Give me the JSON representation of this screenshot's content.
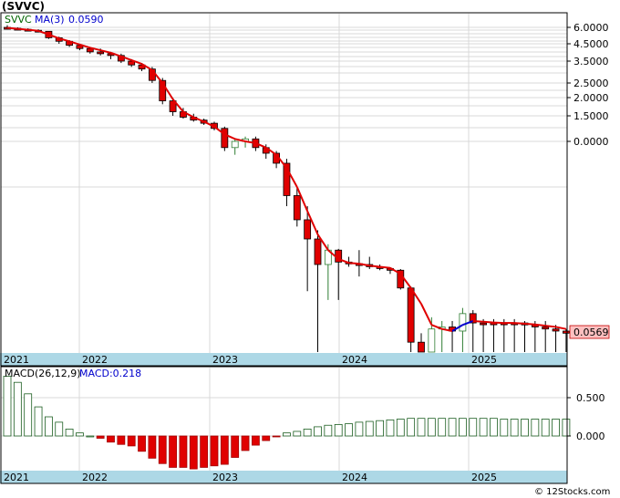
{
  "ticker": "(SVVC)",
  "legend": {
    "symbol": "SVVC",
    "ma_label": "MA(3)",
    "ma_value": "0.0590",
    "macd_label": "MACD(26,12,9)",
    "macd_value": "MACD:0.218"
  },
  "last_price_label": "0.0569",
  "watermark": "© 12Stocks.com",
  "year_labels": [
    "2021",
    "2022",
    "2023",
    "2024",
    "2025"
  ],
  "price_ticks": [
    "6.0000",
    "4.5000",
    "3.5000",
    "2.5000",
    "2.0000",
    "1.5000",
    "0.0000"
  ],
  "macd_ticks": [
    "0.500",
    "0.000"
  ],
  "colors": {
    "up": "#2e7d32",
    "down": "#e00000",
    "ma": "#e00000",
    "ma_alt": "#0000cc",
    "band": "#add8e6",
    "price_tag_bg": "#ffc0c0",
    "grid": "#d8d8d8"
  },
  "chart_data": {
    "type": "candlestick",
    "interval": "monthly",
    "series": [
      {
        "name": "SVVC",
        "role": "price",
        "values": [
          [
            6.0,
            6.2,
            5.8,
            5.9
          ],
          [
            5.9,
            6.0,
            5.7,
            5.8
          ],
          [
            5.8,
            5.9,
            5.6,
            5.7
          ],
          [
            5.7,
            5.8,
            5.5,
            5.6
          ],
          [
            5.6,
            5.6,
            4.9,
            5.0
          ],
          [
            5.0,
            5.1,
            4.5,
            4.7
          ],
          [
            4.7,
            4.8,
            4.3,
            4.4
          ],
          [
            4.4,
            4.5,
            4.1,
            4.2
          ],
          [
            4.2,
            4.3,
            3.9,
            4.0
          ],
          [
            4.0,
            4.2,
            3.8,
            3.9
          ],
          [
            3.9,
            4.0,
            3.6,
            3.8
          ],
          [
            3.8,
            3.9,
            3.4,
            3.5
          ],
          [
            3.5,
            3.6,
            3.2,
            3.3
          ],
          [
            3.3,
            3.4,
            3.0,
            3.1
          ],
          [
            3.1,
            3.2,
            2.5,
            2.6
          ],
          [
            2.6,
            2.7,
            1.8,
            1.9
          ],
          [
            1.9,
            2.0,
            1.5,
            1.6
          ],
          [
            1.6,
            1.7,
            1.4,
            1.45
          ],
          [
            1.45,
            1.55,
            1.3,
            1.35
          ],
          [
            1.35,
            1.4,
            1.2,
            1.25
          ],
          [
            1.25,
            1.3,
            1.05,
            1.1
          ],
          [
            1.1,
            1.15,
            0.65,
            0.7
          ],
          [
            0.7,
            0.85,
            0.6,
            0.8
          ],
          [
            0.8,
            0.9,
            0.7,
            0.85
          ],
          [
            0.85,
            0.9,
            0.65,
            0.7
          ],
          [
            0.7,
            0.75,
            0.55,
            0.62
          ],
          [
            0.62,
            0.65,
            0.45,
            0.5
          ],
          [
            0.5,
            0.55,
            0.2,
            0.25
          ],
          [
            0.25,
            0.3,
            0.13,
            0.15
          ],
          [
            0.15,
            0.2,
            0.04,
            0.1
          ],
          [
            0.1,
            0.12,
            0.02,
            0.06
          ],
          [
            0.06,
            0.09,
            0.035,
            0.08
          ],
          [
            0.08,
            0.082,
            0.035,
            0.063
          ],
          [
            0.063,
            0.07,
            0.058,
            0.061
          ],
          [
            0.061,
            0.08,
            0.05,
            0.06
          ],
          [
            0.06,
            0.07,
            0.056,
            0.058
          ],
          [
            0.058,
            0.06,
            0.055,
            0.0565
          ],
          [
            0.0565,
            0.0575,
            0.052,
            0.055
          ],
          [
            0.055,
            0.056,
            0.041,
            0.042
          ],
          [
            0.042,
            0.043,
            0.02,
            0.022
          ],
          [
            0.022,
            0.024,
            0.018,
            0.02
          ],
          [
            0.02,
            0.028,
            0.018,
            0.025
          ],
          [
            0.025,
            0.027,
            0.018,
            0.0255
          ],
          [
            0.0255,
            0.027,
            0.018,
            0.0245
          ],
          [
            0.0245,
            0.031,
            0.02,
            0.029
          ],
          [
            0.029,
            0.03,
            0.0185,
            0.0265
          ],
          [
            0.0265,
            0.0275,
            0.0185,
            0.0265
          ],
          [
            0.0265,
            0.0275,
            0.0185,
            0.0265
          ],
          [
            0.0265,
            0.0275,
            0.0185,
            0.0265
          ],
          [
            0.0265,
            0.0275,
            0.0185,
            0.0265
          ],
          [
            0.0265,
            0.027,
            0.0185,
            0.026
          ],
          [
            0.026,
            0.027,
            0.0185,
            0.0255
          ],
          [
            0.0255,
            0.027,
            0.0185,
            0.025
          ],
          [
            0.025,
            0.026,
            0.0185,
            0.0245
          ],
          [
            0.0245,
            0.025,
            0.019,
            0.024
          ]
        ]
      },
      {
        "name": "MA(3)",
        "role": "ma",
        "values": [
          5.95,
          5.85,
          5.75,
          5.65,
          5.3,
          4.95,
          4.7,
          4.45,
          4.25,
          4.1,
          3.95,
          3.75,
          3.55,
          3.35,
          3.05,
          2.5,
          1.95,
          1.6,
          1.45,
          1.3,
          1.15,
          0.95,
          0.85,
          0.8,
          0.77,
          0.7,
          0.6,
          0.45,
          0.3,
          0.18,
          0.11,
          0.08,
          0.067,
          0.062,
          0.061,
          0.059,
          0.058,
          0.057,
          0.052,
          0.042,
          0.033,
          0.026,
          0.025,
          0.0245,
          0.026,
          0.027,
          0.0268,
          0.0266,
          0.0265,
          0.0265,
          0.0263,
          0.0261,
          0.0258,
          0.0255,
          0.025
        ]
      },
      {
        "name": "MACD(26,12,9)",
        "role": "macd",
        "values": [
          0.78,
          0.7,
          0.55,
          0.38,
          0.25,
          0.18,
          0.09,
          0.04,
          0.0,
          -0.03,
          -0.08,
          -0.11,
          -0.13,
          -0.2,
          -0.29,
          -0.36,
          -0.41,
          -0.41,
          -0.43,
          -0.41,
          -0.39,
          -0.37,
          -0.28,
          -0.19,
          -0.12,
          -0.06,
          -0.01,
          0.04,
          0.06,
          0.09,
          0.12,
          0.14,
          0.15,
          0.16,
          0.18,
          0.19,
          0.2,
          0.21,
          0.22,
          0.23,
          0.23,
          0.23,
          0.23,
          0.23,
          0.23,
          0.23,
          0.23,
          0.23,
          0.22,
          0.22,
          0.22,
          0.22,
          0.22,
          0.22,
          0.22
        ]
      }
    ],
    "price_axis_ticks": [
      6.0,
      4.5,
      3.5,
      2.5,
      2.0,
      1.5,
      0.0
    ],
    "macd_axis_ticks": [
      0.5,
      0.0
    ],
    "ylim_macd": [
      -0.43,
      0.78
    ],
    "legend_position": "top-left",
    "grid": true
  }
}
